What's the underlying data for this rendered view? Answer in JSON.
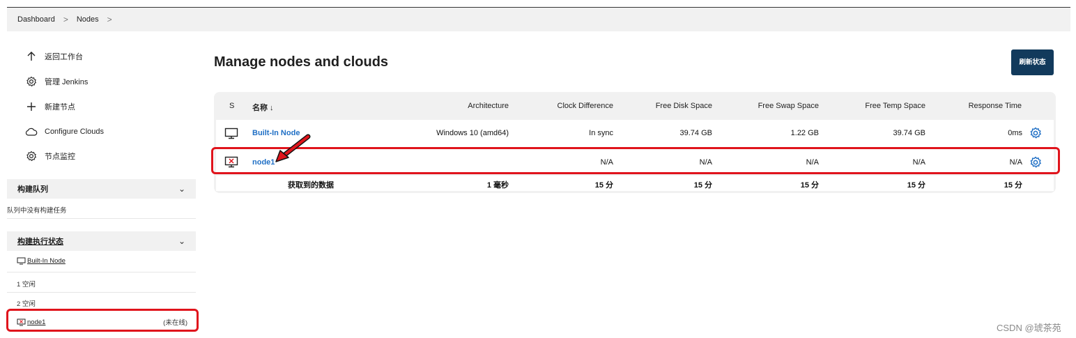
{
  "breadcrumb": {
    "item1": "Dashboard",
    "item2": "Nodes",
    "sep": ">"
  },
  "sidebar": {
    "items": [
      {
        "label": "返回工作台",
        "icon": "arrow-up-icon"
      },
      {
        "label": "管理 Jenkins",
        "icon": "gear-icon"
      },
      {
        "label": "新建节点",
        "icon": "plus-icon"
      },
      {
        "label": "Configure Clouds",
        "icon": "cloud-icon"
      },
      {
        "label": "节点监控",
        "icon": "gear-icon"
      }
    ],
    "build_queue": {
      "title": "构建队列",
      "empty_text": "队列中没有构建任务"
    },
    "executor_status": {
      "title": "构建执行状态",
      "builtin_label": "Built-In Node",
      "exec1": "1  空闲",
      "exec2": "2  空闲",
      "node1_label": "node1",
      "node1_status": "(未在线)"
    }
  },
  "main": {
    "title": "Manage nodes and clouds",
    "refresh_label": "刷新状态",
    "columns": [
      "S",
      "名称 ↓",
      "Architecture",
      "Clock Difference",
      "Free Disk Space",
      "Free Swap Space",
      "Free Temp Space",
      "Response Time"
    ],
    "rows": [
      {
        "name": "Built-In Node",
        "arch": "Windows 10 (amd64)",
        "clock": "In sync",
        "disk": "39.74 GB",
        "swap": "1.22 GB",
        "temp": "39.74 GB",
        "resp": "0ms"
      },
      {
        "name": "node1",
        "arch": "",
        "clock": "N/A",
        "disk": "N/A",
        "swap": "N/A",
        "temp": "N/A",
        "resp": "N/A"
      }
    ],
    "footer": {
      "label": "获取到的数据",
      "arch": "1 毫秒",
      "clock": "15 分",
      "disk": "15 分",
      "swap": "15 分",
      "temp": "15 分",
      "resp": "15 分"
    }
  },
  "watermark": "CSDN @琥茶苑",
  "colors": {
    "accent": "#1f6fc5",
    "button": "#123a5c",
    "highlight": "#e0141c"
  }
}
